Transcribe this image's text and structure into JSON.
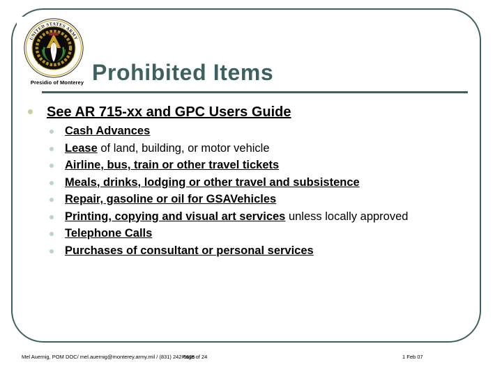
{
  "slide": {
    "title": "Prohibited Items",
    "logo_caption": "Presidio of Monterey",
    "logo_alt": "us-army-acquisition-corps-seal",
    "seal_ring_top": "UNITED  STATES  ARMY",
    "seal_ring_bottom": "ACQUISITION  CORPS"
  },
  "colors": {
    "accent": "#3d6160",
    "bullet_level1": "#cdcda0",
    "bullet_level2": "#b9d3d3",
    "text": "#000000"
  },
  "content": {
    "heading": "See AR 715-xx and GPC Users Guide",
    "items": [
      {
        "emphasis": "Cash Advances",
        "rest": ""
      },
      {
        "emphasis": "Lease",
        "rest": " of land, building, or motor vehicle"
      },
      {
        "emphasis": "Airline, bus, train or other travel tickets",
        "rest": ""
      },
      {
        "emphasis": "Meals, drinks, lodging or other travel and subsistence",
        "rest": ""
      },
      {
        "emphasis": "Repair, gasoline or oil for GSAVehicles",
        "rest": ""
      },
      {
        "emphasis": "Printing, copying and visual art services",
        "rest": " unless locally approved"
      },
      {
        "emphasis": "Telephone Calls",
        "rest": ""
      },
      {
        "emphasis": "Purchases of consultant or personal services",
        "rest": ""
      }
    ]
  },
  "footer": {
    "contact": "Mel Auernig, POM DOC/ mel.auernig@monterey.army.mil / (831) 242-6605",
    "page": "Page  of 24",
    "date": "1 Feb 07"
  }
}
